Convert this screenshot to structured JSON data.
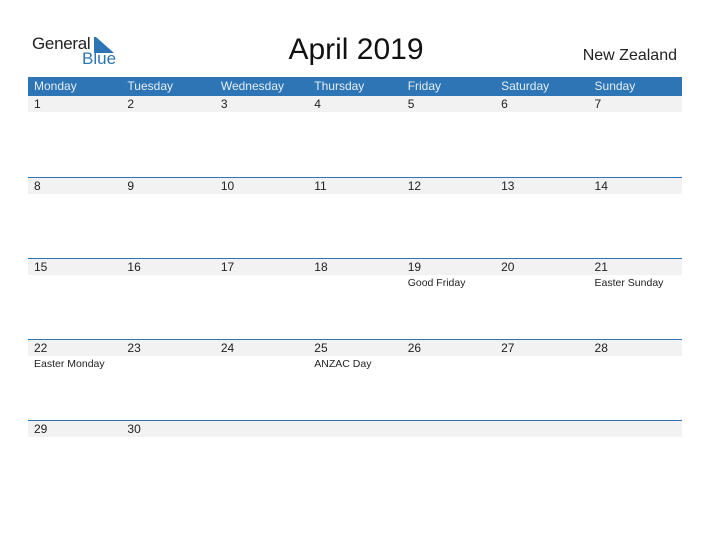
{
  "logo": {
    "general": "General",
    "blue": "Blue",
    "icon": "triangle-flag-icon",
    "accent": "#2e75b6"
  },
  "title": "April 2019",
  "country": "New Zealand",
  "weekdays": [
    "Monday",
    "Tuesday",
    "Wednesday",
    "Thursday",
    "Friday",
    "Saturday",
    "Sunday"
  ],
  "weeks": [
    [
      {
        "day": "1",
        "holiday": ""
      },
      {
        "day": "2",
        "holiday": ""
      },
      {
        "day": "3",
        "holiday": ""
      },
      {
        "day": "4",
        "holiday": ""
      },
      {
        "day": "5",
        "holiday": ""
      },
      {
        "day": "6",
        "holiday": ""
      },
      {
        "day": "7",
        "holiday": ""
      }
    ],
    [
      {
        "day": "8",
        "holiday": ""
      },
      {
        "day": "9",
        "holiday": ""
      },
      {
        "day": "10",
        "holiday": ""
      },
      {
        "day": "11",
        "holiday": ""
      },
      {
        "day": "12",
        "holiday": ""
      },
      {
        "day": "13",
        "holiday": ""
      },
      {
        "day": "14",
        "holiday": ""
      }
    ],
    [
      {
        "day": "15",
        "holiday": ""
      },
      {
        "day": "16",
        "holiday": ""
      },
      {
        "day": "17",
        "holiday": ""
      },
      {
        "day": "18",
        "holiday": ""
      },
      {
        "day": "19",
        "holiday": "Good Friday"
      },
      {
        "day": "20",
        "holiday": ""
      },
      {
        "day": "21",
        "holiday": "Easter Sunday"
      }
    ],
    [
      {
        "day": "22",
        "holiday": "Easter Monday"
      },
      {
        "day": "23",
        "holiday": ""
      },
      {
        "day": "24",
        "holiday": ""
      },
      {
        "day": "25",
        "holiday": "ANZAC Day"
      },
      {
        "day": "26",
        "holiday": ""
      },
      {
        "day": "27",
        "holiday": ""
      },
      {
        "day": "28",
        "holiday": ""
      }
    ],
    [
      {
        "day": "29",
        "holiday": ""
      },
      {
        "day": "30",
        "holiday": ""
      },
      {
        "day": "",
        "holiday": ""
      },
      {
        "day": "",
        "holiday": ""
      },
      {
        "day": "",
        "holiday": ""
      },
      {
        "day": "",
        "holiday": ""
      },
      {
        "day": "",
        "holiday": ""
      }
    ]
  ]
}
